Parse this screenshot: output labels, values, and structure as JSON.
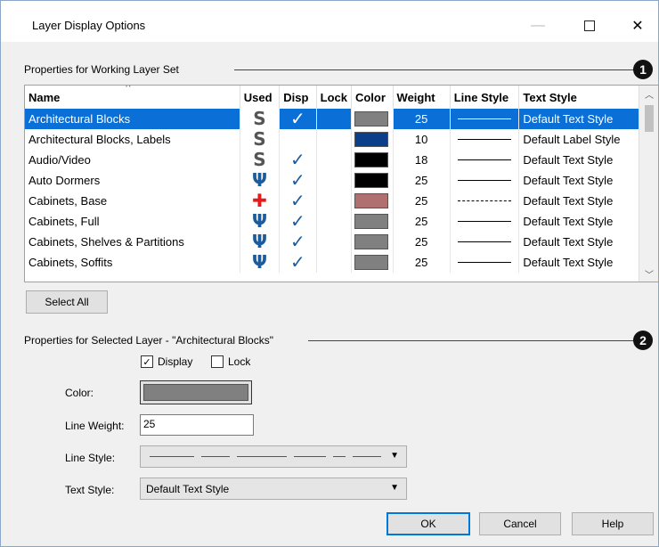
{
  "window": {
    "title": "Layer Display Options",
    "minimize_glyph": "—",
    "close_glyph": "✕"
  },
  "group1": {
    "label": "Properties for  Working Layer Set",
    "badge": "1"
  },
  "table": {
    "columns": [
      "Name",
      "Used",
      "Disp",
      "Lock",
      "Color",
      "Weight",
      "Line Style",
      "Text Style"
    ],
    "rows": [
      {
        "name": "Architectural Blocks",
        "used": "S",
        "used_icon": "s-icon",
        "disp": true,
        "lock": false,
        "color": "#808080",
        "weight": "25",
        "line_style": "solid",
        "text_style": "Default Text Style",
        "selected": true
      },
      {
        "name": "Architectural Blocks, Labels",
        "used": "S",
        "used_icon": "s-icon",
        "disp": false,
        "lock": false,
        "color": "#0b3f8a",
        "weight": "10",
        "line_style": "solid",
        "text_style": "Default Label Style",
        "selected": false
      },
      {
        "name": "Audio/Video",
        "used": "S",
        "used_icon": "s-icon",
        "disp": true,
        "lock": false,
        "color": "#000000",
        "weight": "18",
        "line_style": "solid",
        "text_style": "Default Text Style",
        "selected": false
      },
      {
        "name": "Auto Dormers",
        "used": "Ψ",
        "used_icon": "tool-icon",
        "disp": true,
        "lock": false,
        "color": "#000000",
        "weight": "25",
        "line_style": "solid",
        "text_style": "Default Text Style",
        "selected": false
      },
      {
        "name": "Cabinets,  Base",
        "used": "✚",
        "used_icon": "plus-icon",
        "disp": true,
        "lock": false,
        "color": "#b07070",
        "weight": "25",
        "line_style": "dashed",
        "text_style": "Default Text Style",
        "selected": false
      },
      {
        "name": "Cabinets,  Full",
        "used": "Ψ",
        "used_icon": "tool-icon",
        "disp": true,
        "lock": false,
        "color": "#808080",
        "weight": "25",
        "line_style": "solid",
        "text_style": "Default Text Style",
        "selected": false
      },
      {
        "name": "Cabinets,  Shelves & Partitions",
        "used": "Ψ",
        "used_icon": "tool-icon",
        "disp": true,
        "lock": false,
        "color": "#808080",
        "weight": "25",
        "line_style": "solid",
        "text_style": "Default Text Style",
        "selected": false
      },
      {
        "name": "Cabinets,  Soffits",
        "used": "Ψ",
        "used_icon": "tool-icon",
        "disp": true,
        "lock": false,
        "color": "#808080",
        "weight": "25",
        "line_style": "solid",
        "text_style": "Default Text Style",
        "selected": false
      }
    ]
  },
  "select_all_label": "Select All",
  "group2": {
    "label": "Properties for Selected Layer - \"Architectural Blocks\"",
    "badge": "2"
  },
  "display_checkbox": {
    "label": "Display",
    "checked": true
  },
  "lock_checkbox": {
    "label": "Lock",
    "checked": false
  },
  "fields": {
    "color_label": "Color:",
    "color_value": "#808080",
    "line_weight_label": "Line Weight:",
    "line_weight_value": "25",
    "line_style_label": "Line Style:",
    "text_style_label": "Text Style:",
    "text_style_value": "Default Text Style"
  },
  "buttons": {
    "ok": "OK",
    "cancel": "Cancel",
    "help": "Help"
  }
}
